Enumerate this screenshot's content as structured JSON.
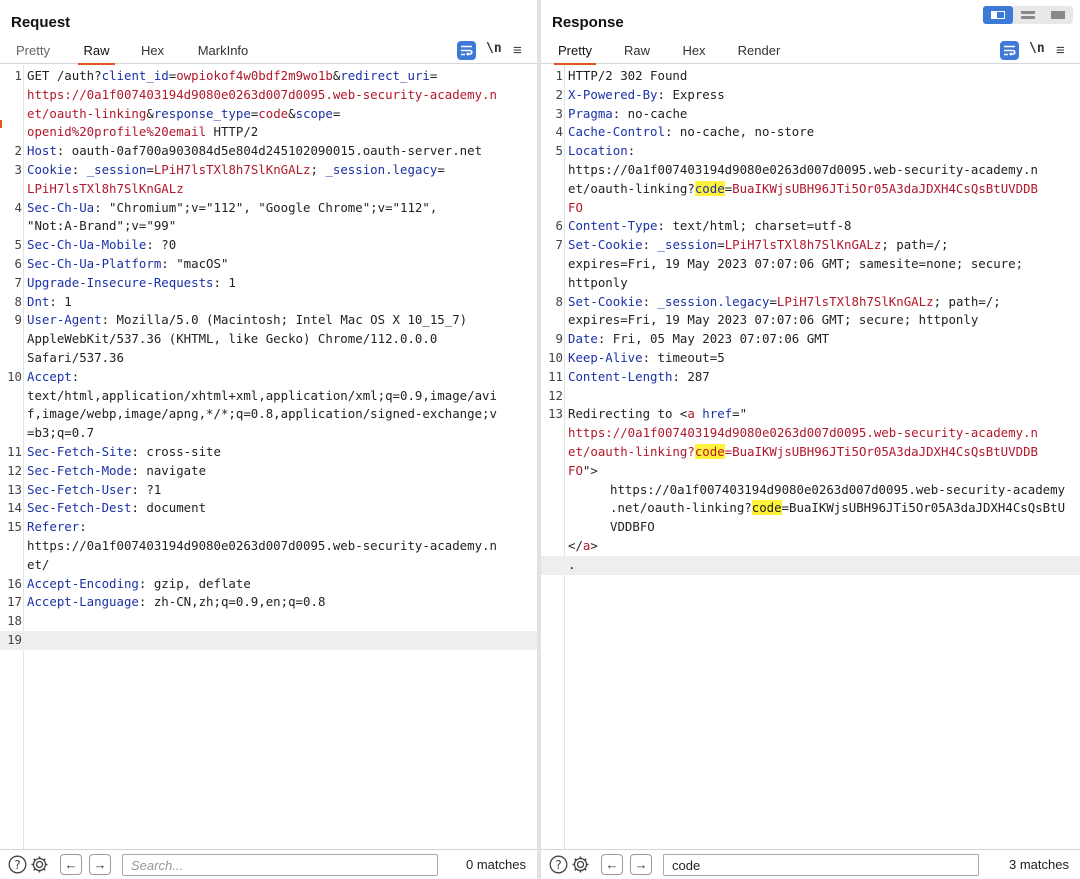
{
  "request": {
    "title": "Request",
    "tabs": [
      "Pretty",
      "Raw",
      "Hex",
      "MarkInfo"
    ],
    "active_tab": "Raw",
    "newline_toggle": "\\n",
    "search": {
      "placeholder": "Search...",
      "value": "",
      "matches": "0 matches"
    },
    "lines": [
      {
        "n": "1",
        "segs": [
          [
            "p",
            "GET /auth?"
          ],
          [
            "k",
            "client_id"
          ],
          [
            "p",
            "="
          ],
          [
            "v",
            "owpiokof4w0bdf2m9wo1b"
          ],
          [
            "p",
            "&"
          ],
          [
            "k",
            "redirect_uri"
          ],
          [
            "p",
            "="
          ]
        ]
      },
      {
        "n": "",
        "segs": [
          [
            "v",
            "https://0a1f007403194d9080e0263d007d0095.web-security-academy.n"
          ]
        ]
      },
      {
        "n": "",
        "segs": [
          [
            "v",
            "et/oauth-linking"
          ],
          [
            "p",
            "&"
          ],
          [
            "k",
            "response_type"
          ],
          [
            "p",
            "="
          ],
          [
            "v",
            "code"
          ],
          [
            "p",
            "&"
          ],
          [
            "k",
            "scope"
          ],
          [
            "p",
            "="
          ]
        ]
      },
      {
        "n": "",
        "segs": [
          [
            "v",
            "openid%20profile%20email"
          ],
          [
            "p",
            " HTTP/2"
          ]
        ]
      },
      {
        "n": "2",
        "segs": [
          [
            "k",
            "Host"
          ],
          [
            "p",
            ": oauth-0af700a903084d5e804d245102090015.oauth-server.net"
          ]
        ]
      },
      {
        "n": "3",
        "segs": [
          [
            "k",
            "Cookie"
          ],
          [
            "p",
            ": "
          ],
          [
            "k",
            "_session"
          ],
          [
            "p",
            "="
          ],
          [
            "v",
            "LPiH7lsTXl8h7SlKnGALz"
          ],
          [
            "p",
            "; "
          ],
          [
            "k",
            "_session.legacy"
          ],
          [
            "p",
            "="
          ]
        ]
      },
      {
        "n": "",
        "segs": [
          [
            "v",
            "LPiH7lsTXl8h7SlKnGALz"
          ]
        ]
      },
      {
        "n": "4",
        "segs": [
          [
            "k",
            "Sec-Ch-Ua"
          ],
          [
            "p",
            ": \"Chromium\";v=\"112\", \"Google Chrome\";v=\"112\","
          ]
        ]
      },
      {
        "n": "",
        "segs": [
          [
            "p",
            "\"Not:A-Brand\";v=\"99\""
          ]
        ]
      },
      {
        "n": "5",
        "segs": [
          [
            "k",
            "Sec-Ch-Ua-Mobile"
          ],
          [
            "p",
            ": ?0"
          ]
        ]
      },
      {
        "n": "6",
        "segs": [
          [
            "k",
            "Sec-Ch-Ua-Platform"
          ],
          [
            "p",
            ": \"macOS\""
          ]
        ]
      },
      {
        "n": "7",
        "segs": [
          [
            "k",
            "Upgrade-Insecure-Requests"
          ],
          [
            "p",
            ": 1"
          ]
        ]
      },
      {
        "n": "8",
        "segs": [
          [
            "k",
            "Dnt"
          ],
          [
            "p",
            ": 1"
          ]
        ]
      },
      {
        "n": "9",
        "segs": [
          [
            "k",
            "User-Agent"
          ],
          [
            "p",
            ": Mozilla/5.0 (Macintosh; Intel Mac OS X 10_15_7)"
          ]
        ]
      },
      {
        "n": "",
        "segs": [
          [
            "p",
            "AppleWebKit/537.36 (KHTML, like Gecko) Chrome/112.0.0.0"
          ]
        ]
      },
      {
        "n": "",
        "segs": [
          [
            "p",
            "Safari/537.36"
          ]
        ]
      },
      {
        "n": "10",
        "segs": [
          [
            "k",
            "Accept"
          ],
          [
            "p",
            ":"
          ]
        ]
      },
      {
        "n": "",
        "segs": [
          [
            "p",
            "text/html,application/xhtml+xml,application/xml;q=0.9,image/avi"
          ]
        ]
      },
      {
        "n": "",
        "segs": [
          [
            "p",
            "f,image/webp,image/apng,*/*;q=0.8,application/signed-exchange;v"
          ]
        ]
      },
      {
        "n": "",
        "segs": [
          [
            "p",
            "=b3;q=0.7"
          ]
        ]
      },
      {
        "n": "11",
        "segs": [
          [
            "k",
            "Sec-Fetch-Site"
          ],
          [
            "p",
            ": cross-site"
          ]
        ]
      },
      {
        "n": "12",
        "segs": [
          [
            "k",
            "Sec-Fetch-Mode"
          ],
          [
            "p",
            ": navigate"
          ]
        ]
      },
      {
        "n": "13",
        "segs": [
          [
            "k",
            "Sec-Fetch-User"
          ],
          [
            "p",
            ": ?1"
          ]
        ]
      },
      {
        "n": "14",
        "segs": [
          [
            "k",
            "Sec-Fetch-Dest"
          ],
          [
            "p",
            ": document"
          ]
        ]
      },
      {
        "n": "15",
        "segs": [
          [
            "k",
            "Referer"
          ],
          [
            "p",
            ":"
          ]
        ]
      },
      {
        "n": "",
        "segs": [
          [
            "p",
            "https://0a1f007403194d9080e0263d007d0095.web-security-academy.n"
          ]
        ]
      },
      {
        "n": "",
        "segs": [
          [
            "p",
            "et/"
          ]
        ]
      },
      {
        "n": "16",
        "segs": [
          [
            "k",
            "Accept-Encoding"
          ],
          [
            "p",
            ": gzip, deflate"
          ]
        ]
      },
      {
        "n": "17",
        "segs": [
          [
            "k",
            "Accept-Language"
          ],
          [
            "p",
            ": zh-CN,zh;q=0.9,en;q=0.8"
          ]
        ]
      },
      {
        "n": "18",
        "segs": []
      },
      {
        "n": "19",
        "segs": [],
        "hl": true
      }
    ]
  },
  "response": {
    "title": "Response",
    "tabs": [
      "Pretty",
      "Raw",
      "Hex",
      "Render"
    ],
    "active_tab": "Pretty",
    "newline_toggle": "\\n",
    "search": {
      "placeholder": "Search...",
      "value": "code",
      "matches": "3 matches"
    },
    "lines": [
      {
        "n": "1",
        "segs": [
          [
            "p",
            "HTTP/2 302 Found"
          ]
        ]
      },
      {
        "n": "2",
        "segs": [
          [
            "k",
            "X-Powered-By"
          ],
          [
            "p",
            ": Express"
          ]
        ]
      },
      {
        "n": "3",
        "segs": [
          [
            "k",
            "Pragma"
          ],
          [
            "p",
            ": no-cache"
          ]
        ]
      },
      {
        "n": "4",
        "segs": [
          [
            "k",
            "Cache-Control"
          ],
          [
            "p",
            ": no-cache, no-store"
          ]
        ]
      },
      {
        "n": "5",
        "segs": [
          [
            "k",
            "Location"
          ],
          [
            "p",
            ":"
          ]
        ]
      },
      {
        "n": "",
        "segs": [
          [
            "p",
            "https://0a1f007403194d9080e0263d007d0095.web-security-academy.n"
          ]
        ]
      },
      {
        "n": "",
        "segs": [
          [
            "p",
            "et/oauth-linking?"
          ],
          [
            "km",
            "code"
          ],
          [
            "p",
            "="
          ],
          [
            "v",
            "BuaIKWjsUBH96JTi5Or05A3daJDXH4CsQsBtUVDDB"
          ]
        ]
      },
      {
        "n": "",
        "segs": [
          [
            "v",
            "FO"
          ]
        ]
      },
      {
        "n": "6",
        "segs": [
          [
            "k",
            "Content-Type"
          ],
          [
            "p",
            ": text/html; charset=utf-8"
          ]
        ]
      },
      {
        "n": "7",
        "segs": [
          [
            "k",
            "Set-Cookie"
          ],
          [
            "p",
            ": "
          ],
          [
            "k",
            "_session"
          ],
          [
            "p",
            "="
          ],
          [
            "v",
            "LPiH7lsTXl8h7SlKnGALz"
          ],
          [
            "p",
            "; path=/;"
          ]
        ]
      },
      {
        "n": "",
        "segs": [
          [
            "p",
            "expires=Fri, 19 May 2023 07:07:06 GMT; samesite=none; secure;"
          ]
        ]
      },
      {
        "n": "",
        "segs": [
          [
            "p",
            "httponly"
          ]
        ]
      },
      {
        "n": "8",
        "segs": [
          [
            "k",
            "Set-Cookie"
          ],
          [
            "p",
            ": "
          ],
          [
            "k",
            "_session.legacy"
          ],
          [
            "p",
            "="
          ],
          [
            "v",
            "LPiH7lsTXl8h7SlKnGALz"
          ],
          [
            "p",
            "; path=/;"
          ]
        ]
      },
      {
        "n": "",
        "segs": [
          [
            "p",
            "expires=Fri, 19 May 2023 07:07:06 GMT; secure; httponly"
          ]
        ]
      },
      {
        "n": "9",
        "segs": [
          [
            "k",
            "Date"
          ],
          [
            "p",
            ": Fri, 05 May 2023 07:07:06 GMT"
          ]
        ]
      },
      {
        "n": "10",
        "segs": [
          [
            "k",
            "Keep-Alive"
          ],
          [
            "p",
            ": timeout=5"
          ]
        ]
      },
      {
        "n": "11",
        "segs": [
          [
            "k",
            "Content-Length"
          ],
          [
            "p",
            ": 287"
          ]
        ]
      },
      {
        "n": "12",
        "segs": []
      },
      {
        "n": "13",
        "segs": [
          [
            "p",
            "Redirecting to <"
          ],
          [
            "v",
            "a"
          ],
          [
            "p",
            " "
          ],
          [
            "k",
            "href"
          ],
          [
            "p",
            "=\""
          ]
        ]
      },
      {
        "n": "",
        "segs": [
          [
            "v",
            "https://0a1f007403194d9080e0263d007d0095.web-security-academy.n"
          ]
        ]
      },
      {
        "n": "",
        "segs": [
          [
            "v",
            "et/oauth-linking?"
          ],
          [
            "vm",
            "code"
          ],
          [
            "v",
            "=BuaIKWjsUBH96JTi5Or05A3daJDXH4CsQsBtUVDDB"
          ]
        ]
      },
      {
        "n": "",
        "segs": [
          [
            "v",
            "FO"
          ],
          [
            "p",
            "\">"
          ]
        ]
      },
      {
        "n": "",
        "cont": true,
        "segs": [
          [
            "p",
            "https://0a1f007403194d9080e0263d007d0095.web-security-academy"
          ]
        ]
      },
      {
        "n": "",
        "cont": true,
        "segs": [
          [
            "p",
            ".net/oauth-linking?"
          ],
          [
            "pm",
            "code"
          ],
          [
            "p",
            "=BuaIKWjsUBH96JTi5Or05A3daJDXH4CsQsBtU"
          ]
        ]
      },
      {
        "n": "",
        "cont": true,
        "segs": [
          [
            "p",
            "VDDBFO"
          ]
        ]
      },
      {
        "n": "",
        "segs": [
          [
            "p",
            "</"
          ],
          [
            "v",
            "a"
          ],
          [
            "p",
            ">"
          ]
        ]
      },
      {
        "n": "",
        "segs": [
          [
            "p",
            "."
          ]
        ],
        "hl": true
      }
    ]
  },
  "icons": {
    "wrap": "wrap-lines-icon",
    "menu": "menu-icon",
    "help": "help-icon",
    "settings": "gear-icon",
    "prev": "arrow-left-icon",
    "next": "arrow-right-icon"
  },
  "colors": {
    "accent": "#e2551e",
    "blue": "#3d7ad8",
    "header_key": "#1b32a6",
    "value": "#b2182b",
    "highlight": "#fff23a"
  }
}
